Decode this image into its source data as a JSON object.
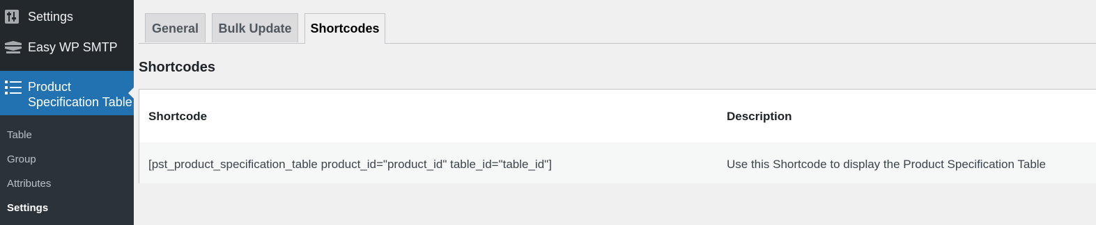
{
  "sidebar": {
    "items": [
      {
        "label": "Settings",
        "icon": "settings-sliders-icon"
      },
      {
        "label": "Easy WP SMTP",
        "icon": "envelope-tray-icon"
      },
      {
        "label_line1": "Product",
        "label_line2": "Specification Table",
        "icon": "list-icon",
        "current": true
      }
    ],
    "submenu": [
      {
        "label": "Table"
      },
      {
        "label": "Group"
      },
      {
        "label": "Attributes"
      },
      {
        "label": "Settings",
        "active": true
      }
    ]
  },
  "tabs": [
    {
      "label": "General"
    },
    {
      "label": "Bulk Update"
    },
    {
      "label": "Shortcodes",
      "active": true
    }
  ],
  "main": {
    "title": "Shortcodes",
    "table": {
      "headers": [
        "Shortcode",
        "Description"
      ],
      "rows": [
        [
          "[pst_product_specification_table product_id=\"product_id\" table_id=\"table_id\"]",
          "Use this Shortcode to display the Product Specification Table"
        ]
      ]
    }
  },
  "colors": {
    "sidebar_bg": "#23282d",
    "submenu_bg": "#2c3338",
    "accent": "#2271b1",
    "page_bg": "#f0f0f1"
  }
}
